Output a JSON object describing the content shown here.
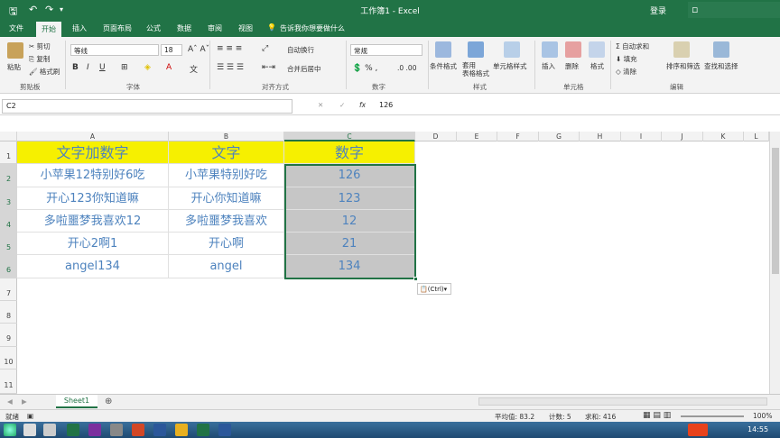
{
  "window": {
    "title": "工作簿1 - Excel",
    "login": "登录"
  },
  "tabs": [
    "文件",
    "开始",
    "插入",
    "页面布局",
    "公式",
    "数据",
    "审阅",
    "视图"
  ],
  "active_tab": "开始",
  "tell_me": "告诉我你想要做什么",
  "ribbon": {
    "paste": "粘贴",
    "cut": "剪切",
    "copy": "复制",
    "format_painter": "格式刷",
    "clipboard": "剪贴板",
    "font_name": "等线",
    "font_size": "18",
    "font_group": "字体",
    "wrap": "自动换行",
    "merge": "合并后居中",
    "align_group": "对齐方式",
    "num_format": "常规",
    "number_group": "数字",
    "cond_format": "条件格式",
    "table_format": "套用\n表格格式",
    "cell_style": "单元格样式",
    "styles_group": "样式",
    "insert": "插入",
    "delete": "删除",
    "format": "格式",
    "cells_group": "单元格",
    "autosum": "自动求和",
    "fill": "填充",
    "clear": "清除",
    "sort": "排序和筛选",
    "find": "查找和选择",
    "edit_group": "编辑"
  },
  "formula_bar": {
    "name_box": "C2",
    "fx": "fx",
    "value": "126"
  },
  "columns": [
    "A",
    "B",
    "C",
    "D",
    "E",
    "F",
    "G",
    "H",
    "I",
    "J",
    "K",
    "L"
  ],
  "rows": [
    "1",
    "2",
    "3",
    "4",
    "5",
    "6",
    "7",
    "8",
    "9",
    "10",
    "11"
  ],
  "table": {
    "header": [
      "文字加数字",
      "文字",
      "数字"
    ],
    "rows": [
      [
        "小苹果12特别好6吃",
        "小苹果特别好吃",
        "126"
      ],
      [
        "开心123你知道嘛",
        "开心你知道嘛",
        "123"
      ],
      [
        "多啦噩梦我喜欢12",
        "多啦噩梦我喜欢",
        "12"
      ],
      [
        "开心2啊1",
        "开心啊",
        "21"
      ],
      [
        "angel134",
        "angel",
        "134"
      ]
    ]
  },
  "paste_options": "(Ctrl)",
  "sheet": "Sheet1",
  "status": {
    "mode": "就绪",
    "average": "平均值: 83.2",
    "count": "计数: 5",
    "sum": "求和: 416",
    "zoom": "100%"
  },
  "taskbar": {
    "time": "14:55"
  }
}
